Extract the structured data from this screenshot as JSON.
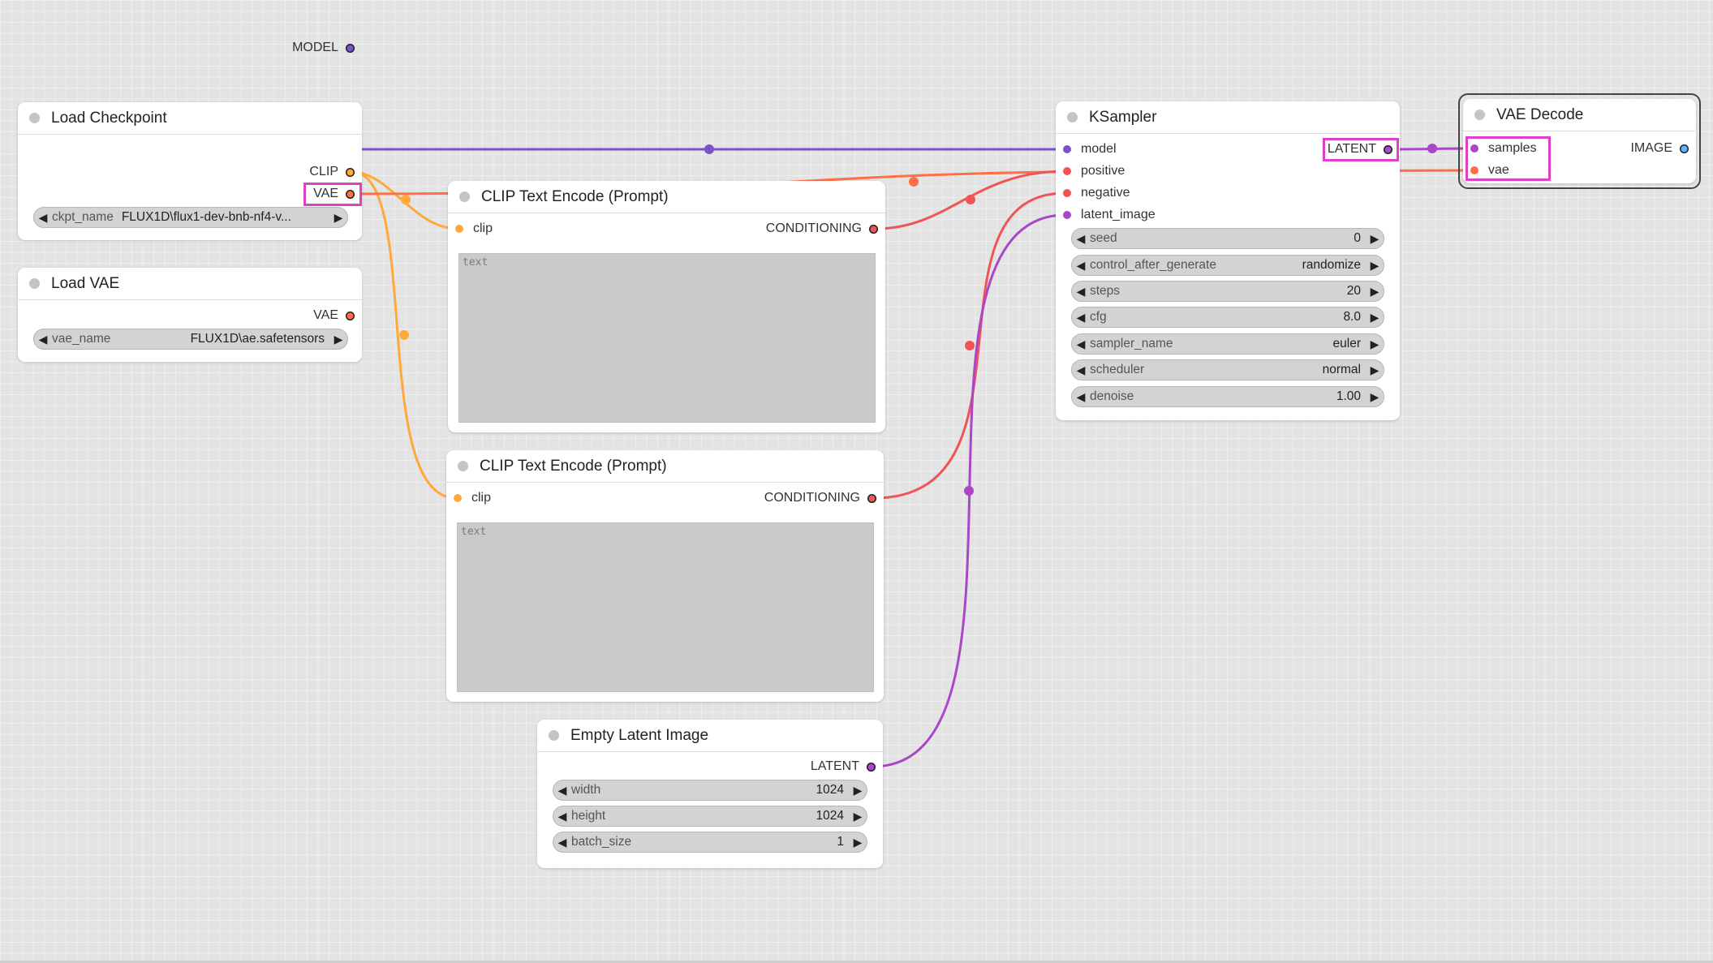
{
  "colors": {
    "model": "#7b52c8",
    "clip": "#ffa93a",
    "vae": "#ff6e46",
    "conditioning": "#f05454",
    "latent": "#aa46c8",
    "image": "#64b4ff",
    "highlight": "#e040c8"
  },
  "nodes": {
    "load_checkpoint": {
      "title": "Load Checkpoint",
      "outputs": [
        "MODEL",
        "CLIP",
        "VAE"
      ],
      "ckpt_name": {
        "label": "ckpt_name",
        "value": "FLUX1D\\flux1-dev-bnb-nf4-v..."
      }
    },
    "load_vae": {
      "title": "Load VAE",
      "outputs": [
        "VAE"
      ],
      "vae_name": {
        "label": "vae_name",
        "value": "FLUX1D\\ae.safetensors"
      }
    },
    "clip_text_encode_1": {
      "title": "CLIP Text Encode (Prompt)",
      "input": "clip",
      "output": "CONDITIONING",
      "placeholder": "text"
    },
    "clip_text_encode_2": {
      "title": "CLIP Text Encode (Prompt)",
      "input": "clip",
      "output": "CONDITIONING",
      "placeholder": "text"
    },
    "empty_latent": {
      "title": "Empty Latent Image",
      "output": "LATENT",
      "widgets": [
        {
          "label": "width",
          "value": "1024"
        },
        {
          "label": "height",
          "value": "1024"
        },
        {
          "label": "batch_size",
          "value": "1"
        }
      ]
    },
    "ksampler": {
      "title": "KSampler",
      "inputs": [
        "model",
        "positive",
        "negative",
        "latent_image"
      ],
      "output": "LATENT",
      "widgets": [
        {
          "label": "seed",
          "value": "0"
        },
        {
          "label": "control_after_generate",
          "value": "randomize"
        },
        {
          "label": "steps",
          "value": "20"
        },
        {
          "label": "cfg",
          "value": "8.0"
        },
        {
          "label": "sampler_name",
          "value": "euler"
        },
        {
          "label": "scheduler",
          "value": "normal"
        },
        {
          "label": "denoise",
          "value": "1.00"
        }
      ]
    },
    "vae_decode": {
      "title": "VAE Decode",
      "inputs": [
        "samples",
        "vae"
      ],
      "output": "IMAGE"
    }
  }
}
